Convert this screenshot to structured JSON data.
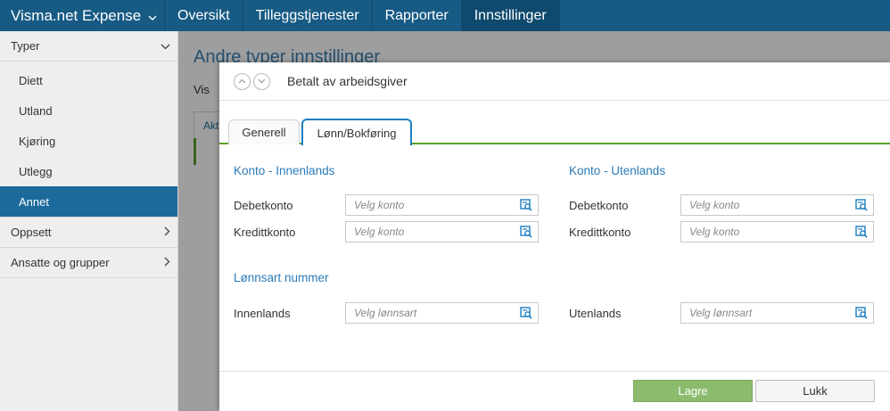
{
  "app": {
    "brand": "Visma.net Expense"
  },
  "nav": {
    "items": [
      {
        "label": "Oversikt",
        "active": false
      },
      {
        "label": "Tilleggstjenester",
        "active": false
      },
      {
        "label": "Rapporter",
        "active": false
      },
      {
        "label": "Innstillinger",
        "active": true
      }
    ]
  },
  "sidebar": {
    "typer": "Typer",
    "items": [
      {
        "label": "Diett"
      },
      {
        "label": "Utland"
      },
      {
        "label": "Kjøring"
      },
      {
        "label": "Utlegg"
      },
      {
        "label": "Annet",
        "active": true
      }
    ],
    "oppsett": "Oppsett",
    "ansatte": "Ansatte og grupper"
  },
  "background": {
    "title": "Andre typer innstillinger",
    "vis": "Vis",
    "tab": "Akti"
  },
  "modal": {
    "title": "Betalt av arbeidsgiver",
    "tabs": {
      "generell": "Generell",
      "lonn": "Lønn/Bokføring"
    },
    "innenlands": {
      "heading": "Konto - Innenlands",
      "debet_label": "Debetkonto",
      "debet_placeholder": "Velg konto",
      "kreditt_label": "Kredittkonto",
      "kreditt_placeholder": "Velg konto"
    },
    "utenlands": {
      "heading": "Konto - Utenlands",
      "debet_label": "Debetkonto",
      "debet_placeholder": "Velg konto",
      "kreditt_label": "Kredittkonto",
      "kreditt_placeholder": "Velg konto"
    },
    "lonnsart": {
      "heading": "Lønnsart nummer",
      "innenlands_label": "Innenlands",
      "innenlands_placeholder": "Velg lønnsart",
      "utenlands_label": "Utenlands",
      "utenlands_placeholder": "Velg lønnsart"
    },
    "footer": {
      "save": "Lagre",
      "close": "Lukk"
    }
  },
  "colors": {
    "nav_bg": "#175a84",
    "accent_blue": "#1c6a9c",
    "tab_underline": "#5aa02c",
    "save_button": "#8cbb6e"
  }
}
